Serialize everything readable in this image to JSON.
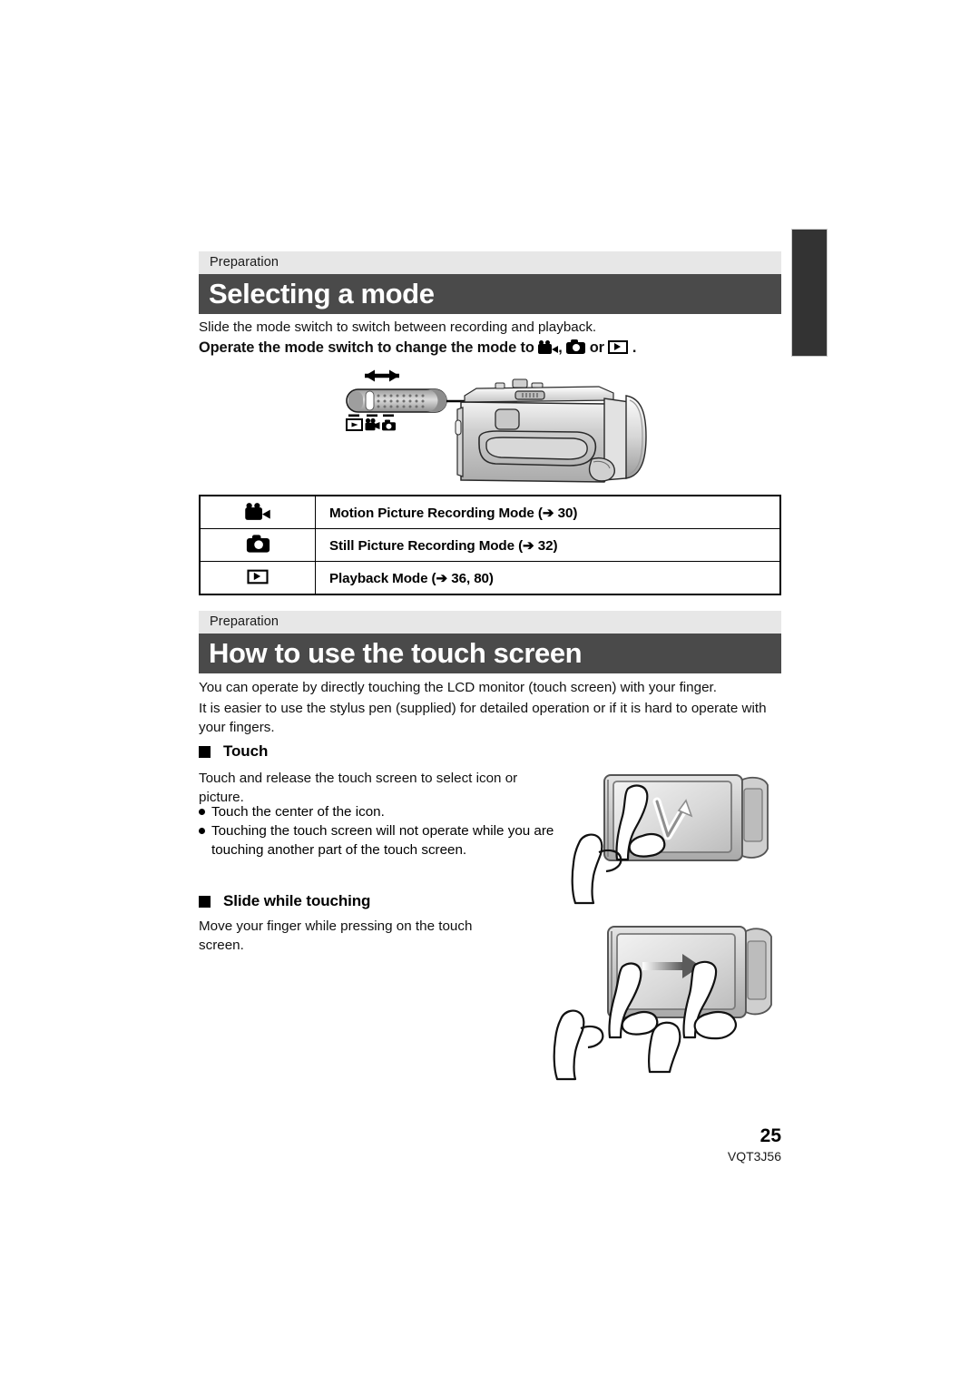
{
  "page": {
    "number": "25",
    "code": "VQT3J56"
  },
  "sections": [
    {
      "kicker": "Preparation",
      "title": "Selecting a mode",
      "intro": "Slide the mode switch to switch between recording and playback.",
      "instruction_prefix": "Operate the mode switch to change the mode to",
      "instruction_sep": ",",
      "instruction_or": "or",
      "instruction_end": ".",
      "instruction_icons": [
        "video-camera-icon",
        "still-camera-icon",
        "playback-icon"
      ]
    },
    {
      "kicker": "Preparation",
      "title": "How to use the touch screen",
      "paragraphs": [
        "You can operate by directly touching the LCD monitor (touch screen) with your finger.",
        "It is easier to use the stylus pen (supplied) for detailed operation or if it is hard to operate with your fingers."
      ]
    }
  ],
  "mode_table": {
    "rows": [
      {
        "icon": "video-camera-icon",
        "label_before": "Motion Picture Recording Mode (",
        "arrow": "➔",
        "pages": "30",
        "label_after": ")"
      },
      {
        "icon": "still-camera-icon",
        "label_before": "Still Picture Recording Mode (",
        "arrow": "➔",
        "pages": "32",
        "label_after": ")"
      },
      {
        "icon": "playback-icon",
        "label_before": "Playback Mode (",
        "arrow": "➔",
        "pages": "36, 80",
        "label_after": ")"
      }
    ]
  },
  "touch_block": {
    "heading": "Touch",
    "lead": "Touch and release the touch screen to select icon or picture.",
    "bullets": [
      "Touch the center of the icon.",
      "Touching the touch screen will not operate while you are touching another part of the touch screen."
    ]
  },
  "slide_block": {
    "heading": "Slide while touching",
    "lead": "Move your finger while pressing on the touch screen."
  },
  "mode_switch_diagram": {
    "icons": [
      "playback-icon",
      "video-camera-icon",
      "still-camera-icon"
    ],
    "arrow": "double-headed-arrow"
  },
  "colors": {
    "kicker_bg": "#e7e7e7",
    "title_bg": "#4a4a4a",
    "title_fg": "#ffffff",
    "tab_marker": "#333333",
    "text": "#111111"
  }
}
